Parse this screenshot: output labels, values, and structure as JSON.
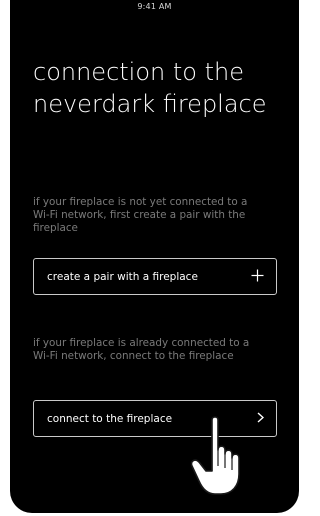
{
  "status_bar": {
    "time": "9:41 AM"
  },
  "screen": {
    "title": "connection to the neverdark fireplace",
    "section_new": {
      "description": "if your fireplace is not yet connected to a Wi-Fi network, first create a pair with the fireplace",
      "button_label": "create a pair with a fireplace",
      "button_icon": "plus-icon"
    },
    "section_existing": {
      "description": "if your fireplace is already connected to a Wi-Fi network, connect to the fireplace",
      "button_label": "connect to the fireplace",
      "button_icon": "chevron-right-icon"
    }
  },
  "colors": {
    "background": "#000000",
    "text": "#ffffff",
    "muted_text": "#7a7a7a",
    "button_border": "#c9c9c9"
  }
}
